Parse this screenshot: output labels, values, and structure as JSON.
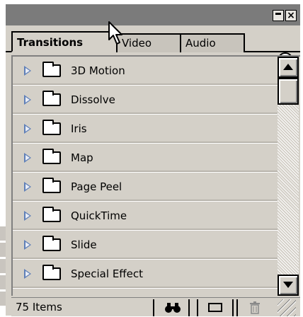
{
  "window": {
    "minimize_icon": "minimize-icon",
    "close_icon": "close-icon",
    "close_glyph": "×"
  },
  "tabs": [
    {
      "label": "Transitions",
      "active": true
    },
    {
      "label": "Video",
      "active": false
    },
    {
      "label": "Audio",
      "active": false
    }
  ],
  "menu_icon": "palette-menu-arrow-icon",
  "items": [
    {
      "label": "3D Motion"
    },
    {
      "label": "Dissolve"
    },
    {
      "label": "Iris"
    },
    {
      "label": "Map"
    },
    {
      "label": "Page Peel"
    },
    {
      "label": "QuickTime"
    },
    {
      "label": "Slide"
    },
    {
      "label": "Special Effect"
    }
  ],
  "status": {
    "item_count": "75 Items",
    "find_icon": "binoculars-icon",
    "find_glyph": "🔭",
    "new_bin_icon": "new-bin-icon",
    "trash_icon": "trash-icon",
    "trash_glyph": "🗑"
  },
  "colors": {
    "panel": "#d4d0c8",
    "titlebar": "#7b7b7b",
    "expander": "#5e7fb8"
  }
}
